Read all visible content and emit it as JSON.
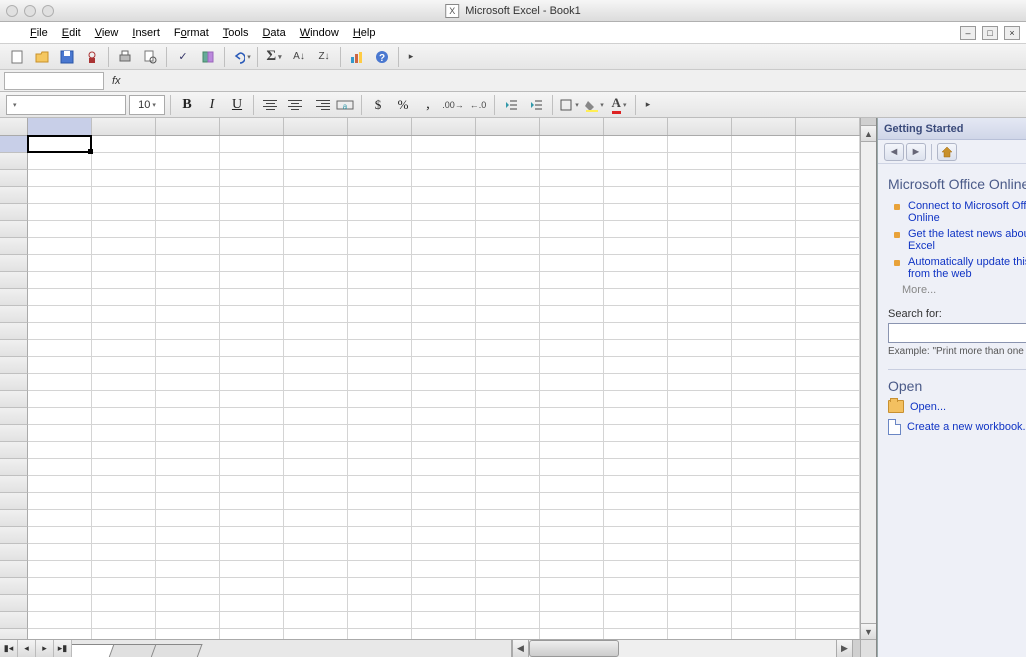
{
  "window": {
    "title": "Microsoft Excel - Book1"
  },
  "menu": {
    "file": "File",
    "edit": "Edit",
    "view": "View",
    "insert": "Insert",
    "format": "Format",
    "tools": "Tools",
    "data": "Data",
    "window": "Window",
    "help": "Help"
  },
  "formatting": {
    "fontname": "",
    "fontsize": "10"
  },
  "formula": {
    "fx": "fx"
  },
  "sheets": {
    "tab1": "",
    "tab2": "",
    "tab3": ""
  },
  "taskpane": {
    "title": "Getting Started",
    "heading_online": "Microsoft Office Online",
    "links": [
      "Connect to Microsoft Office Online",
      "Get the latest news about using Excel",
      "Automatically update this list from the web"
    ],
    "more": "More...",
    "search_label": "Search for:",
    "search_value": "",
    "example": "Example:  \"Print more than one copy\"",
    "open_heading": "Open",
    "open_link": "Open...",
    "create_link": "Create a new workbook..."
  }
}
